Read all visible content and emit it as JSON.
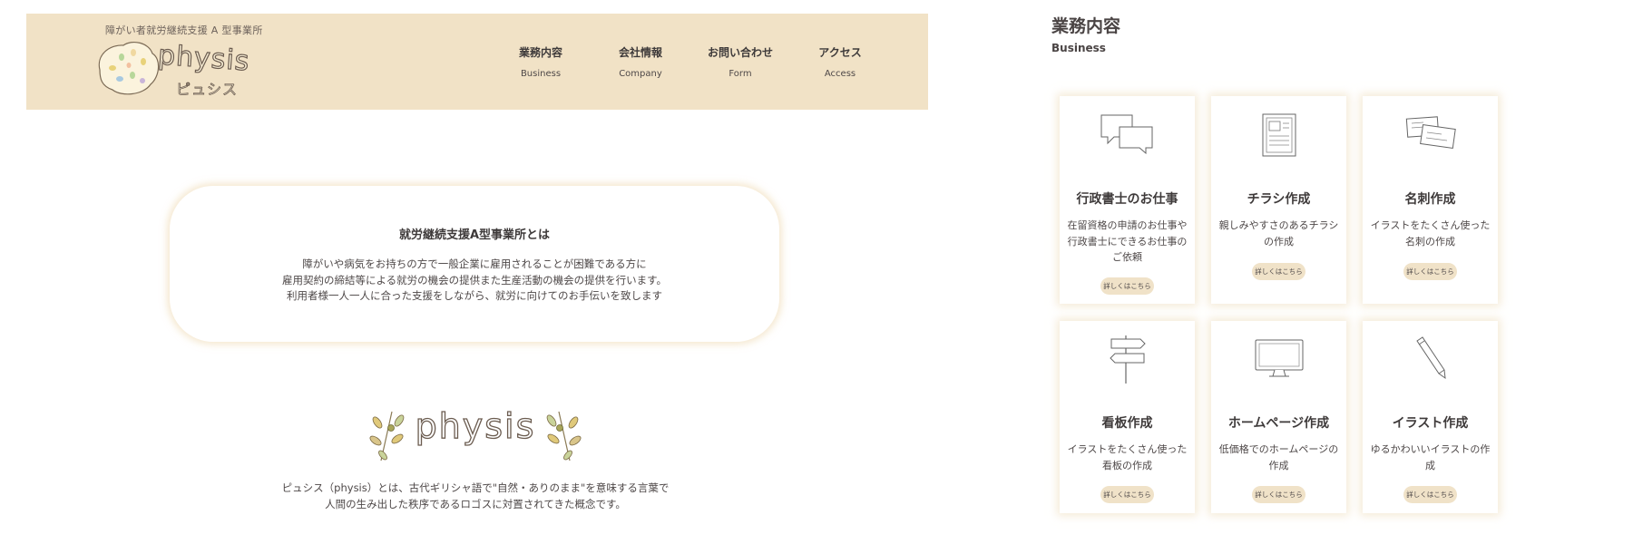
{
  "logo": {
    "tagline": "障がい者就労継続支援 A 型事業所",
    "name": "physis",
    "name_kana": "ピュシス"
  },
  "nav": [
    {
      "jp": "業務内容",
      "en": "Business"
    },
    {
      "jp": "会社情報",
      "en": "Company"
    },
    {
      "jp": "お問い合わせ",
      "en": "Form"
    },
    {
      "jp": "アクセス",
      "en": "Access"
    }
  ],
  "about": {
    "title": "就労継続支援A型事業所とは",
    "lines": [
      "障がいや病気をお持ちの方で一般企業に雇用されることが困難である方に",
      "雇用契約の締結等による就労の機会の提供また生産活動の機会の提供を行います。",
      "利用者様一人一人に合った支援をしながら、就労に向けてのお手伝いを致します"
    ]
  },
  "physis": {
    "emblem_text": "physis",
    "lines": [
      "ピュシス（physis）とは、古代ギリシャ語で\"自然・ありのまま\"を意味する言葉で",
      "人間の生み出した秩序であるロゴスに対置されてきた概念です。"
    ]
  },
  "business": {
    "title": "業務内容",
    "subtitle": "Business",
    "cards": [
      {
        "title": "行政書士のお仕事",
        "desc": [
          "在留資格の申請のお仕事や",
          "行政書士にできるお仕事の",
          "ご依頼"
        ],
        "button": "詳しくはこちら",
        "icon": "speech-bubbles-icon"
      },
      {
        "title": "チラシ作成",
        "desc": [
          "親しみやすさのあるチラシ",
          "の作成"
        ],
        "button": "詳しくはこちら",
        "icon": "flyer-icon"
      },
      {
        "title": "名刺作成",
        "desc": [
          "イラストをたくさん使った",
          "名刺の作成"
        ],
        "button": "詳しくはこちら",
        "icon": "business-card-icon"
      },
      {
        "title": "看板作成",
        "desc": [
          "イラストをたくさん使った",
          "看板の作成"
        ],
        "button": "詳しくはこちら",
        "icon": "signpost-icon"
      },
      {
        "title": "ホームページ作成",
        "desc": [
          "低価格でのホームページの",
          "作成"
        ],
        "button": "詳しくはこちら",
        "icon": "monitor-icon"
      },
      {
        "title": "イラスト作成",
        "desc": [
          "ゆるかわいいイラストの作",
          "成"
        ],
        "button": "詳しくはこちら",
        "icon": "pencil-icon"
      }
    ]
  }
}
